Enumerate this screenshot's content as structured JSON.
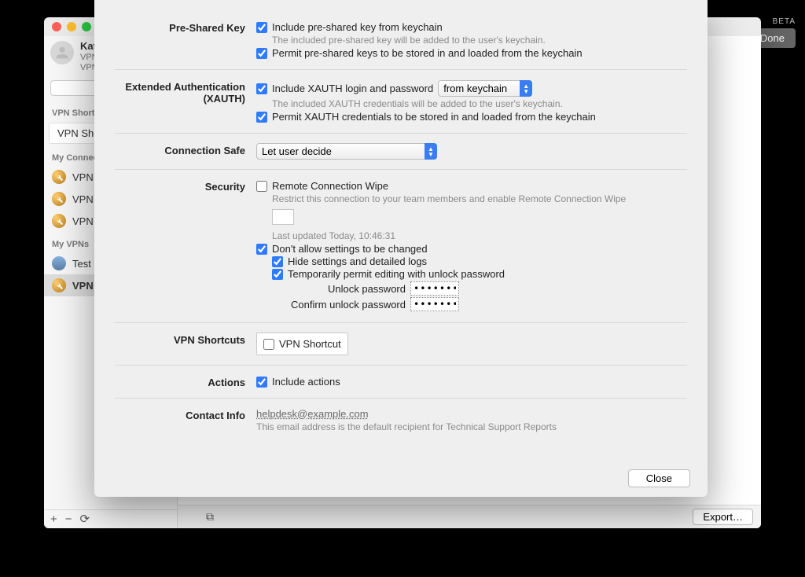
{
  "beta": {
    "label": "BETA",
    "done": "Done"
  },
  "sidebar": {
    "user": {
      "name": "Kats",
      "sub1": "VPN",
      "sub2": "VPN"
    },
    "groups": [
      {
        "title": "VPN Shortcut",
        "items": [
          {
            "label": "VPN Shortc",
            "icon": "none",
            "style": "box"
          }
        ]
      },
      {
        "title": "My Connection",
        "items": [
          {
            "label": "VPN tc",
            "icon": "wrench"
          },
          {
            "label": "VPN tc",
            "icon": "wrench"
          },
          {
            "label": "VPN tc",
            "icon": "wrench"
          }
        ]
      },
      {
        "title": "My VPNs",
        "items": [
          {
            "label": "Test C",
            "icon": "photo"
          },
          {
            "label": "VPN tc",
            "icon": "wrench",
            "selected": true
          }
        ]
      }
    ],
    "footer": {
      "plus": "+",
      "minus": "−",
      "spin": "⟳"
    }
  },
  "sheet": {
    "psk": {
      "title": "Pre-Shared Key",
      "include": "Include pre-shared key from keychain",
      "include_note": "The included pre-shared key will be added to the user's keychain.",
      "permit": "Permit pre-shared keys to be stored in and loaded from the keychain"
    },
    "xauth": {
      "title": "Extended Authentication (XAUTH)",
      "include": "Include XAUTH login and password",
      "source": "from keychain",
      "include_note": "The included XAUTH credentials will be added to the user's keychain.",
      "permit": "Permit XAUTH credentials to be stored in and loaded from the keychain"
    },
    "connsafe": {
      "title": "Connection Safe",
      "value": "Let user decide"
    },
    "security": {
      "title": "Security",
      "wipe": "Remote Connection Wipe",
      "wipe_note": "Restrict this connection to your team members and enable Remote Connection Wipe",
      "updated": "Last updated Today, 10:46:31",
      "lock": "Don't allow settings to be changed",
      "hide": "Hide settings and detailed logs",
      "tempedit": "Temporarily permit editing with unlock password",
      "pw_label": "Unlock password",
      "pw_confirm_label": "Confirm unlock password",
      "pw_mask": "•••••••••"
    },
    "shortcuts": {
      "title": "VPN Shortcuts",
      "item": "VPN Shortcut"
    },
    "actions": {
      "title": "Actions",
      "include": "Include actions"
    },
    "contact": {
      "title": "Contact Info",
      "email": "helpdesk@example.com",
      "note": "This email address is the default recipient for Technical Support Reports"
    },
    "close": "Close"
  },
  "bottom": {
    "export": "Export…"
  }
}
